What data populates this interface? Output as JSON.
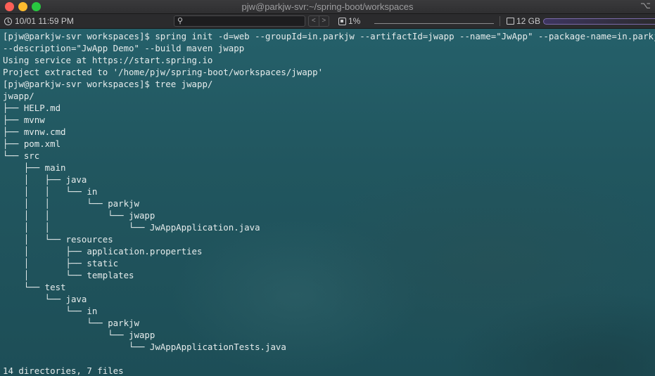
{
  "window": {
    "title": "pjw@parkjw-svr:~/spring-boot/workspaces",
    "corner_glyph": "⌥"
  },
  "statusbar": {
    "datetime": "10/01 11:59 PM",
    "nav_back": "<",
    "nav_forward": ">",
    "cpu": "1%",
    "memory": "12 GB"
  },
  "terminal": {
    "lines": [
      "[pjw@parkjw-svr workspaces]$ spring init -d=web --groupId=in.parkjw --artifactId=jwapp --name=\"JwApp\" --package-name=in.parkjw.jwapp",
      "--description=\"JwApp Demo\" --build maven jwapp",
      "Using service at https://start.spring.io",
      "Project extracted to '/home/pjw/spring-boot/workspaces/jwapp'",
      "[pjw@parkjw-svr workspaces]$ tree jwapp/",
      "jwapp/",
      "├── HELP.md",
      "├── mvnw",
      "├── mvnw.cmd",
      "├── pom.xml",
      "└── src",
      "    ├── main",
      "    │   ├── java",
      "    │   │   └── in",
      "    │   │       └── parkjw",
      "    │   │           └── jwapp",
      "    │   │               └── JwAppApplication.java",
      "    │   └── resources",
      "    │       ├── application.properties",
      "    │       ├── static",
      "    │       └── templates",
      "    └── test",
      "        └── java",
      "            └── in",
      "                └── parkjw",
      "                    └── jwapp",
      "                        └── JwAppApplicationTests.java",
      "",
      "14 directories, 7 files"
    ]
  }
}
